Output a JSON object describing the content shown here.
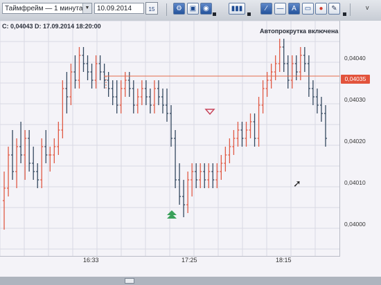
{
  "toolbar": {
    "timeframe": "Таймфрейм — 1 минута",
    "date": "10.09.2014",
    "calendar_day": "15",
    "buttons": [
      "toolbar-button-1",
      "toolbar-button-2",
      "toolbar-button-3",
      "bars-button",
      "line-tool-button",
      "hline-tool-button",
      "text-tool-button",
      "label-tool-button",
      "color-tool-button",
      "delete-tool-button"
    ]
  },
  "info": {
    "ohlc": "C: 0,04043   D: 17.09.2014 18:20:00",
    "autoscroll": "Автопрокрутка включена"
  },
  "axis": {
    "price_labels": [
      "0,04040",
      "0,04030",
      "0,04020",
      "0,04010",
      "0,04000"
    ],
    "current_price": "0,04035",
    "time_labels": [
      "16:33",
      "17:25",
      "18:15"
    ]
  },
  "colors": {
    "up": "#e05a45",
    "down": "#33485f",
    "price_line": "#e36b4a",
    "marker_up": "#3aa15a",
    "marker_down": "#c8455a"
  },
  "chart_data": {
    "type": "bar",
    "ylim": [
      0.03995,
      0.04045
    ],
    "bars": [
      {
        "o": 0.04005,
        "h": 0.04012,
        "l": 0.03998,
        "c": 0.04008
      },
      {
        "o": 0.04008,
        "h": 0.04018,
        "l": 0.04006,
        "c": 0.04016
      },
      {
        "o": 0.04016,
        "h": 0.04022,
        "l": 0.0401,
        "c": 0.04012
      },
      {
        "o": 0.04012,
        "h": 0.0402,
        "l": 0.04008,
        "c": 0.04018
      },
      {
        "o": 0.04018,
        "h": 0.04024,
        "l": 0.04014,
        "c": 0.04016
      },
      {
        "o": 0.04016,
        "h": 0.04022,
        "l": 0.0401,
        "c": 0.0402
      },
      {
        "o": 0.0402,
        "h": 0.04022,
        "l": 0.04012,
        "c": 0.04014
      },
      {
        "o": 0.04014,
        "h": 0.04018,
        "l": 0.0401,
        "c": 0.04012
      },
      {
        "o": 0.04012,
        "h": 0.04014,
        "l": 0.04008,
        "c": 0.0401
      },
      {
        "o": 0.0401,
        "h": 0.0402,
        "l": 0.04008,
        "c": 0.04018
      },
      {
        "o": 0.04018,
        "h": 0.04022,
        "l": 0.04014,
        "c": 0.04016
      },
      {
        "o": 0.04016,
        "h": 0.04018,
        "l": 0.04012,
        "c": 0.04016
      },
      {
        "o": 0.04016,
        "h": 0.0402,
        "l": 0.04014,
        "c": 0.04018
      },
      {
        "o": 0.04018,
        "h": 0.04024,
        "l": 0.04016,
        "c": 0.04022
      },
      {
        "o": 0.04022,
        "h": 0.04034,
        "l": 0.0402,
        "c": 0.04032
      },
      {
        "o": 0.04032,
        "h": 0.04036,
        "l": 0.04026,
        "c": 0.0403
      },
      {
        "o": 0.0403,
        "h": 0.04038,
        "l": 0.04028,
        "c": 0.04036
      },
      {
        "o": 0.04036,
        "h": 0.0404,
        "l": 0.04032,
        "c": 0.04034
      },
      {
        "o": 0.04034,
        "h": 0.04042,
        "l": 0.04032,
        "c": 0.0404
      },
      {
        "o": 0.0404,
        "h": 0.04042,
        "l": 0.04036,
        "c": 0.04038
      },
      {
        "o": 0.04038,
        "h": 0.0404,
        "l": 0.04034,
        "c": 0.04036
      },
      {
        "o": 0.04036,
        "h": 0.04038,
        "l": 0.04032,
        "c": 0.04034
      },
      {
        "o": 0.04034,
        "h": 0.0404,
        "l": 0.04032,
        "c": 0.04038
      },
      {
        "o": 0.04038,
        "h": 0.0404,
        "l": 0.04034,
        "c": 0.04036
      },
      {
        "o": 0.04036,
        "h": 0.04038,
        "l": 0.04032,
        "c": 0.04034
      },
      {
        "o": 0.04034,
        "h": 0.04036,
        "l": 0.0403,
        "c": 0.04032
      },
      {
        "o": 0.04032,
        "h": 0.04034,
        "l": 0.04028,
        "c": 0.0403
      },
      {
        "o": 0.0403,
        "h": 0.04034,
        "l": 0.04026,
        "c": 0.04028
      },
      {
        "o": 0.04028,
        "h": 0.04034,
        "l": 0.04026,
        "c": 0.04032
      },
      {
        "o": 0.04032,
        "h": 0.04036,
        "l": 0.0403,
        "c": 0.04034
      },
      {
        "o": 0.04034,
        "h": 0.04036,
        "l": 0.0403,
        "c": 0.04032
      },
      {
        "o": 0.04032,
        "h": 0.04034,
        "l": 0.04026,
        "c": 0.04028
      },
      {
        "o": 0.04028,
        "h": 0.04032,
        "l": 0.04026,
        "c": 0.0403
      },
      {
        "o": 0.0403,
        "h": 0.04034,
        "l": 0.04028,
        "c": 0.04032
      },
      {
        "o": 0.04032,
        "h": 0.04034,
        "l": 0.04028,
        "c": 0.0403
      },
      {
        "o": 0.0403,
        "h": 0.04032,
        "l": 0.04026,
        "c": 0.04028
      },
      {
        "o": 0.04028,
        "h": 0.04034,
        "l": 0.04026,
        "c": 0.04032
      },
      {
        "o": 0.04032,
        "h": 0.04034,
        "l": 0.04028,
        "c": 0.0403
      },
      {
        "o": 0.0403,
        "h": 0.04032,
        "l": 0.04026,
        "c": 0.04028
      },
      {
        "o": 0.04028,
        "h": 0.04032,
        "l": 0.04024,
        "c": 0.04026
      },
      {
        "o": 0.04026,
        "h": 0.04028,
        "l": 0.04018,
        "c": 0.0402
      },
      {
        "o": 0.0402,
        "h": 0.04022,
        "l": 0.04008,
        "c": 0.0401
      },
      {
        "o": 0.0401,
        "h": 0.04014,
        "l": 0.04004,
        "c": 0.04006
      },
      {
        "o": 0.04006,
        "h": 0.0401,
        "l": 0.04001,
        "c": 0.04004
      },
      {
        "o": 0.04004,
        "h": 0.04012,
        "l": 0.04002,
        "c": 0.0401
      },
      {
        "o": 0.0401,
        "h": 0.04014,
        "l": 0.04006,
        "c": 0.04012
      },
      {
        "o": 0.04012,
        "h": 0.04014,
        "l": 0.04008,
        "c": 0.0401
      },
      {
        "o": 0.0401,
        "h": 0.04014,
        "l": 0.04008,
        "c": 0.04012
      },
      {
        "o": 0.04012,
        "h": 0.04014,
        "l": 0.04008,
        "c": 0.0401
      },
      {
        "o": 0.0401,
        "h": 0.04014,
        "l": 0.04008,
        "c": 0.04012
      },
      {
        "o": 0.04012,
        "h": 0.04014,
        "l": 0.04008,
        "c": 0.0401
      },
      {
        "o": 0.0401,
        "h": 0.04014,
        "l": 0.04008,
        "c": 0.04012
      },
      {
        "o": 0.04012,
        "h": 0.04016,
        "l": 0.0401,
        "c": 0.04014
      },
      {
        "o": 0.04014,
        "h": 0.04018,
        "l": 0.04012,
        "c": 0.04016
      },
      {
        "o": 0.04016,
        "h": 0.0402,
        "l": 0.04014,
        "c": 0.04018
      },
      {
        "o": 0.04018,
        "h": 0.04022,
        "l": 0.04016,
        "c": 0.0402
      },
      {
        "o": 0.0402,
        "h": 0.04024,
        "l": 0.04018,
        "c": 0.04022
      },
      {
        "o": 0.04022,
        "h": 0.04024,
        "l": 0.04018,
        "c": 0.0402
      },
      {
        "o": 0.0402,
        "h": 0.04024,
        "l": 0.04018,
        "c": 0.04022
      },
      {
        "o": 0.04022,
        "h": 0.04026,
        "l": 0.0402,
        "c": 0.04024
      },
      {
        "o": 0.04024,
        "h": 0.04026,
        "l": 0.04018,
        "c": 0.0402
      },
      {
        "o": 0.0402,
        "h": 0.0403,
        "l": 0.04018,
        "c": 0.04028
      },
      {
        "o": 0.04028,
        "h": 0.04034,
        "l": 0.04026,
        "c": 0.04032
      },
      {
        "o": 0.04032,
        "h": 0.04036,
        "l": 0.0403,
        "c": 0.04034
      },
      {
        "o": 0.04034,
        "h": 0.04038,
        "l": 0.04032,
        "c": 0.04036
      },
      {
        "o": 0.04036,
        "h": 0.0404,
        "l": 0.04034,
        "c": 0.04038
      },
      {
        "o": 0.04038,
        "h": 0.04044,
        "l": 0.04036,
        "c": 0.04042
      },
      {
        "o": 0.04042,
        "h": 0.04044,
        "l": 0.04036,
        "c": 0.04038
      },
      {
        "o": 0.04038,
        "h": 0.0404,
        "l": 0.04032,
        "c": 0.04034
      },
      {
        "o": 0.04034,
        "h": 0.0404,
        "l": 0.04032,
        "c": 0.04038
      },
      {
        "o": 0.04038,
        "h": 0.0404,
        "l": 0.04034,
        "c": 0.04036
      },
      {
        "o": 0.04036,
        "h": 0.04042,
        "l": 0.04034,
        "c": 0.0404
      },
      {
        "o": 0.0404,
        "h": 0.04042,
        "l": 0.04036,
        "c": 0.04038
      },
      {
        "o": 0.04038,
        "h": 0.0404,
        "l": 0.0403,
        "c": 0.04032
      },
      {
        "o": 0.04032,
        "h": 0.04034,
        "l": 0.04028,
        "c": 0.0403
      },
      {
        "o": 0.0403,
        "h": 0.04032,
        "l": 0.04026,
        "c": 0.04028
      },
      {
        "o": 0.04028,
        "h": 0.0403,
        "l": 0.04024,
        "c": 0.04026
      },
      {
        "o": 0.04026,
        "h": 0.04028,
        "l": 0.04018,
        "c": 0.0402
      }
    ]
  }
}
